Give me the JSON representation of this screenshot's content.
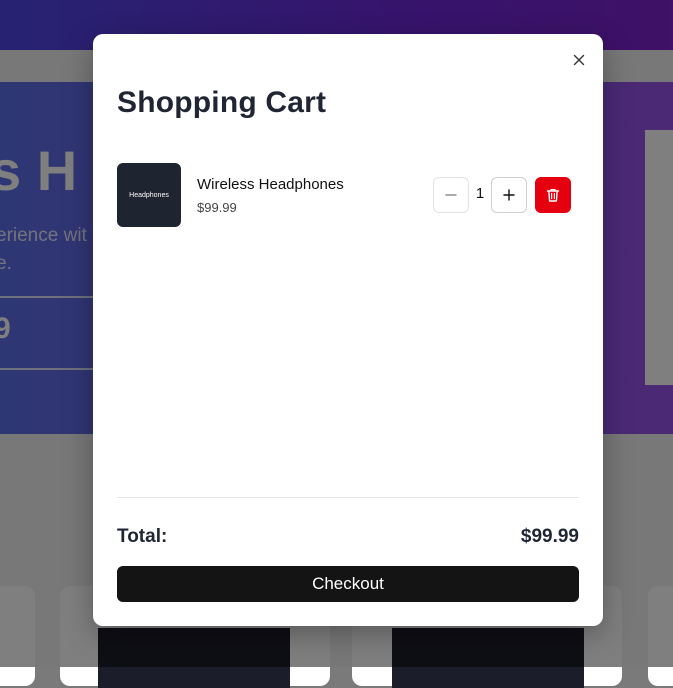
{
  "background": {
    "hero_title": "s H",
    "hero_desc_line1": "erience wit",
    "hero_desc_line2": "e.",
    "hero_price": "9"
  },
  "cart": {
    "title": "Shopping Cart",
    "close_icon": "close-icon",
    "items": [
      {
        "thumb_text": "Headphones",
        "name": "Wireless Headphones",
        "price": "$99.99",
        "quantity": "1"
      }
    ],
    "total_label": "Total:",
    "total_value": "$99.99",
    "checkout_label": "Checkout"
  },
  "colors": {
    "delete_button": "#e5000f",
    "checkout_button": "#141414",
    "hero_gradient_start": "#5b6ee6",
    "hero_gradient_end": "#9a52ea"
  }
}
